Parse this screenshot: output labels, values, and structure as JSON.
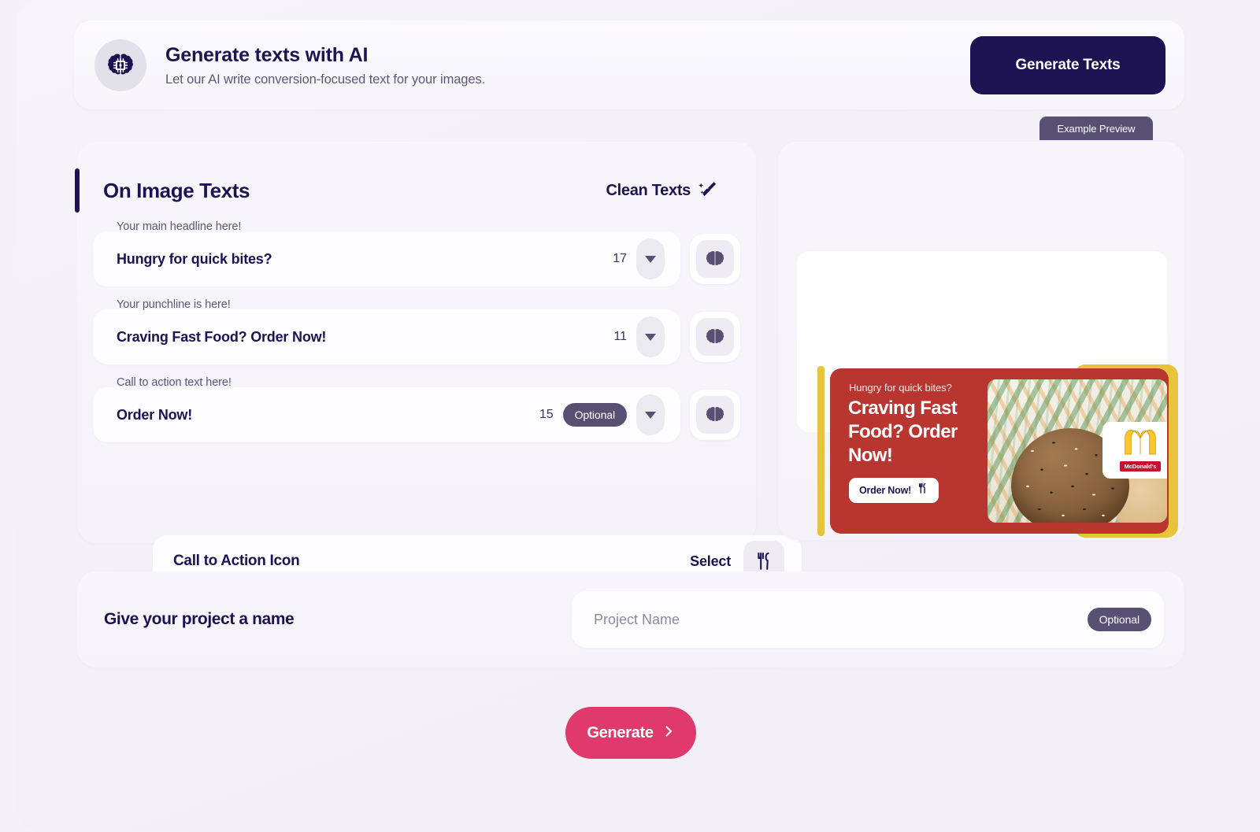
{
  "banner": {
    "icon": "brain-chip-icon",
    "title": "Generate texts with AI",
    "subtitle": "Let our AI write conversion-focused text for your images.",
    "button_label": "Generate Texts"
  },
  "preview_tab": {
    "label": "Example Preview"
  },
  "texts_card": {
    "title": "On Image Texts",
    "clean_texts_label": "Clean Texts",
    "clean_texts_icon": "broom-sparkle-icon",
    "fields": [
      {
        "label": "Your main headline here!",
        "value": "Hungry for quick bites?",
        "count": "17",
        "optional": false,
        "dropdown_icon": "chevron-down-icon",
        "ai_icon": "brain-icon"
      },
      {
        "label": "Your punchline is here!",
        "value": "Craving Fast Food? Order Now!",
        "count": "11",
        "optional": false,
        "dropdown_icon": "chevron-down-icon",
        "ai_icon": "brain-icon"
      },
      {
        "label": "Call to action text here!",
        "value": "Order Now!",
        "count": "15",
        "optional": true,
        "optional_label": "Optional",
        "dropdown_icon": "chevron-down-icon",
        "ai_icon": "brain-icon"
      }
    ],
    "cta_icon_row": {
      "label": "Call to Action Icon",
      "select_label": "Select",
      "icon": "fork-knife-icon"
    }
  },
  "preview": {
    "ad": {
      "kicker": "Hungry for quick bites?",
      "headline": "Craving Fast Food? Order Now!",
      "cta_label": "Order Now!",
      "cta_icon": "fork-knife-icon",
      "brand_wordmark": "McDonald's",
      "brand_logo_icon": "golden-arches-icon",
      "bg_color": "#b93530",
      "accent_color": "#e8c33c"
    }
  },
  "project": {
    "label": "Give your project a name",
    "placeholder": "Project Name",
    "value": "",
    "optional_label": "Optional"
  },
  "footer": {
    "generate_label": "Generate",
    "generate_icon": "chevron-right-icon",
    "generate_color": "#e03a6d"
  }
}
